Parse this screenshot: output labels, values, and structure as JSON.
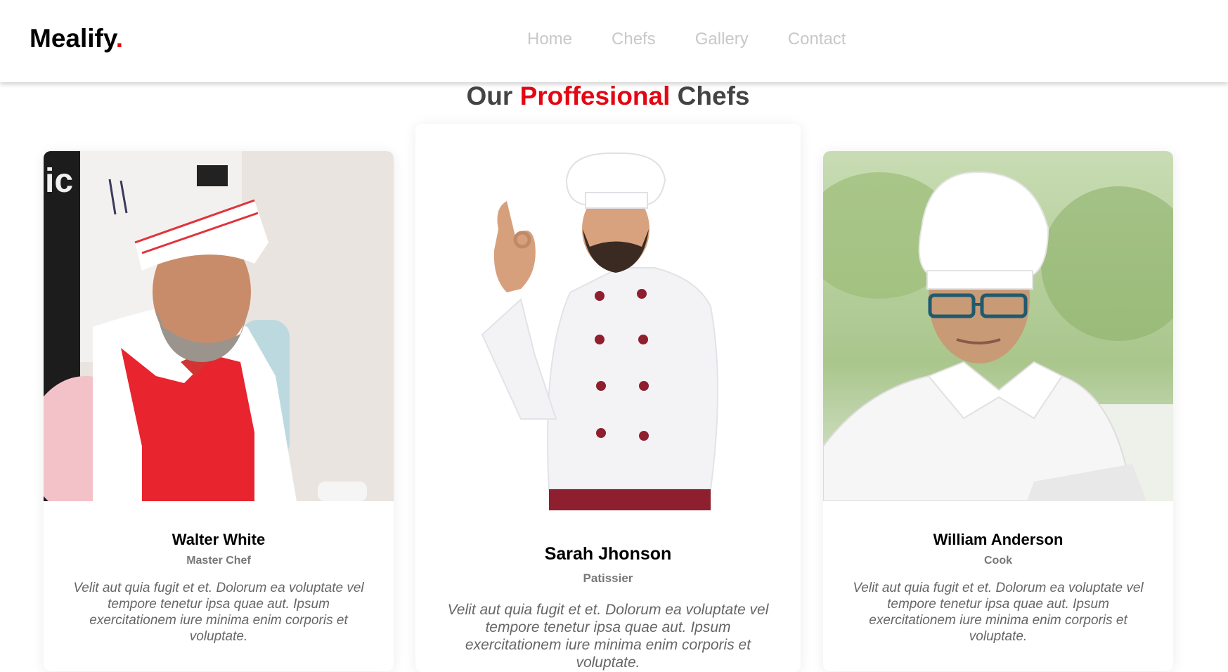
{
  "brand": {
    "name": "Mealify",
    "dot": "."
  },
  "nav": {
    "items": [
      {
        "label": "Home"
      },
      {
        "label": "Chefs"
      },
      {
        "label": "Gallery"
      },
      {
        "label": "Contact"
      }
    ],
    "link_color": "#c8c8c8"
  },
  "section": {
    "title_before": "Our",
    "title_accent": "Proffesional",
    "title_after": "Chefs",
    "accent_color": "#e30613"
  },
  "chefs": [
    {
      "name": "Walter White",
      "role": "Master Chef",
      "description": "Velit aut quia fugit et et. Dolorum ea voluptate vel tempore tenetur ipsa quae aut. Ipsum exercitationem iure minima enim corporis et voluptate.",
      "photo": "chef-photo-red-apron"
    },
    {
      "name": "Sarah Jhonson",
      "role": "Patissier",
      "description": "Velit aut quia fugit et et. Dolorum ea voluptate vel tempore tenetur ipsa quae aut. Ipsum exercitationem iure minima enim corporis et voluptate.",
      "photo": "chef-photo-ok-gesture"
    },
    {
      "name": "William Anderson",
      "role": "Cook",
      "description": "Velit aut quia fugit et et. Dolorum ea voluptate vel tempore tenetur ipsa quae aut. Ipsum exercitationem iure minima enim corporis et voluptate.",
      "photo": "chef-photo-glasses"
    }
  ]
}
